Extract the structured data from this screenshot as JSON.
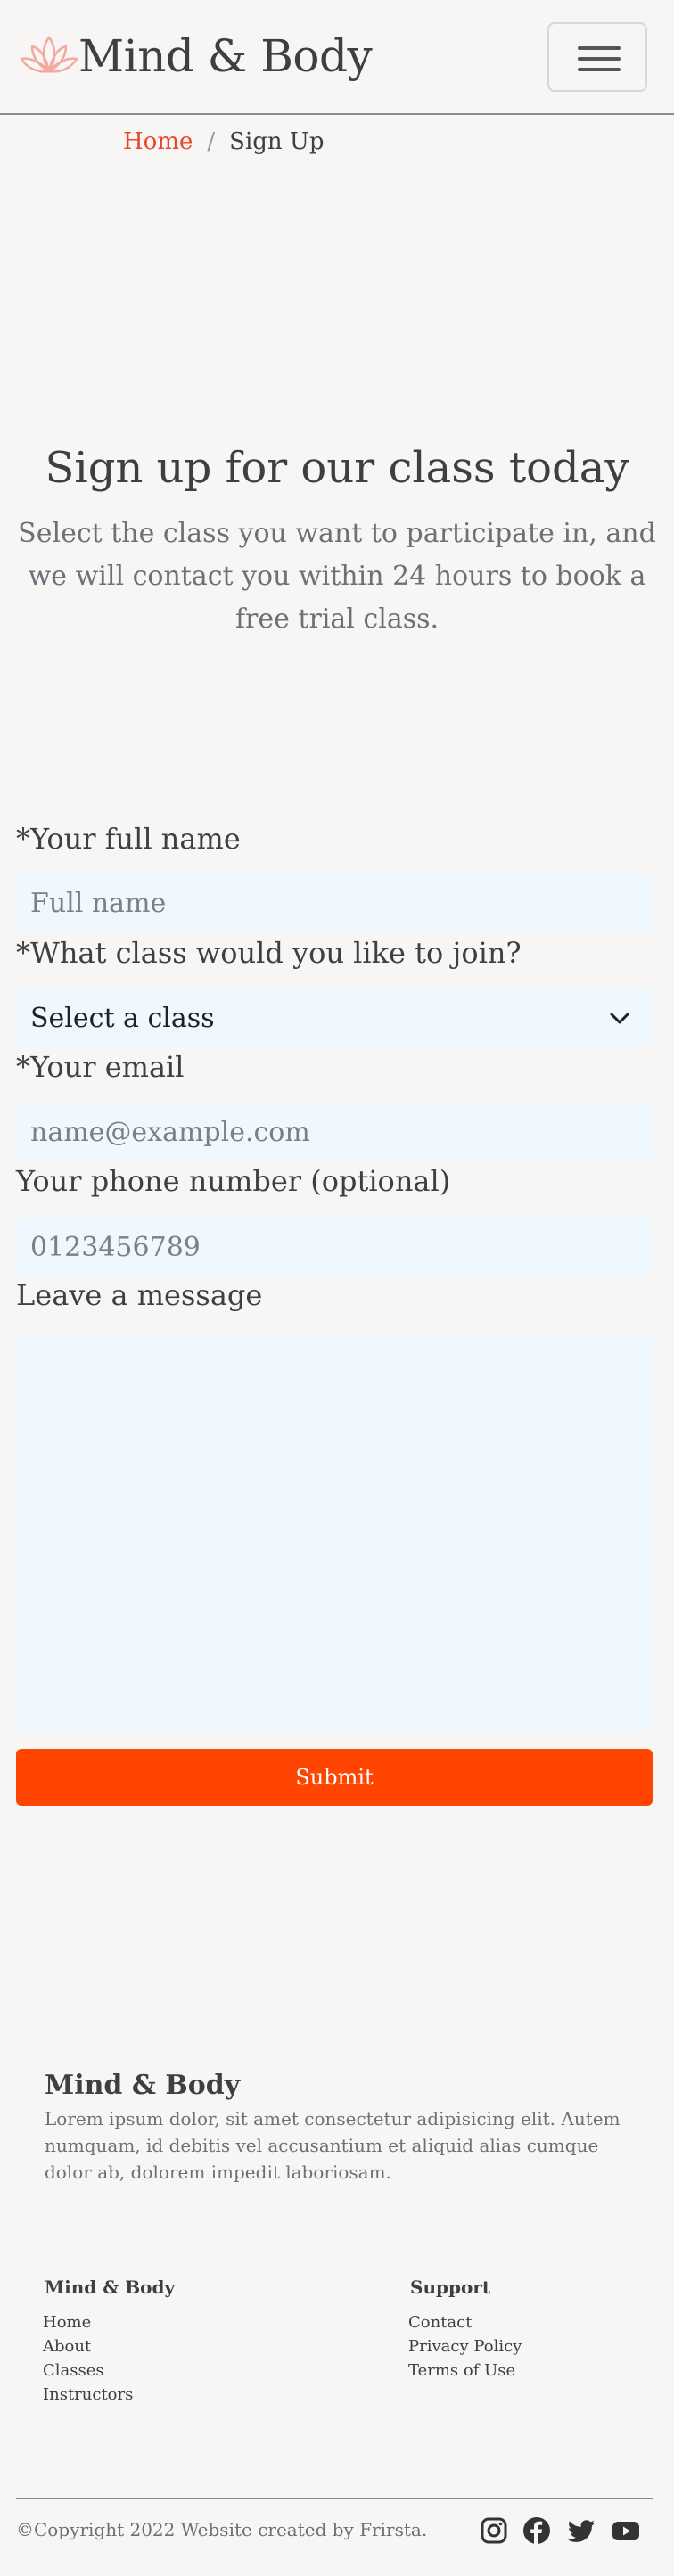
{
  "header": {
    "brand": "Mind & Body",
    "logo_icon": "lotus-icon",
    "menu_icon": "hamburger-menu-icon"
  },
  "breadcrumb": {
    "home": "Home",
    "separator": "/",
    "current": "Sign Up"
  },
  "hero": {
    "title": "Sign up for our class today",
    "subtitle": "Select the class you want to participate in, and we will contact you within 24 hours to book a free trial class."
  },
  "form": {
    "name_label": "*Your full name",
    "name_placeholder": "Full name",
    "class_label": "*What class would you like to join?",
    "class_selected": "Select a class",
    "email_label": "*Your email",
    "email_placeholder": "name@example.com",
    "phone_label": "Your phone number (optional)",
    "phone_placeholder": "0123456789",
    "message_label": "Leave a message",
    "message_value": "",
    "submit_label": "Submit"
  },
  "footer": {
    "brand": "Mind & Body",
    "description": "Lorem ipsum dolor, sit amet consectetur adipisicing elit. Autem numquam, id debitis vel accusantium et aliquid alias cumque dolor ab, dolorem impedit laboriosam.",
    "col1_title": "Mind & Body",
    "col1_items": [
      "Home",
      "About",
      "Classes",
      "Instructors"
    ],
    "col2_title": "Support",
    "col2_items": [
      "Contact",
      "Privacy Policy",
      "Terms of Use"
    ],
    "copyright": "©Copyright 2022 Website created by Frirsta.",
    "social_icons": [
      "instagram-icon",
      "facebook-icon",
      "twitter-icon",
      "youtube-icon"
    ]
  },
  "colors": {
    "accent": "#ff4500",
    "link": "#e8472b",
    "field_bg": "#eef8fe",
    "page_bg": "#f7f6f5",
    "lotus": "#f4a9a0"
  }
}
